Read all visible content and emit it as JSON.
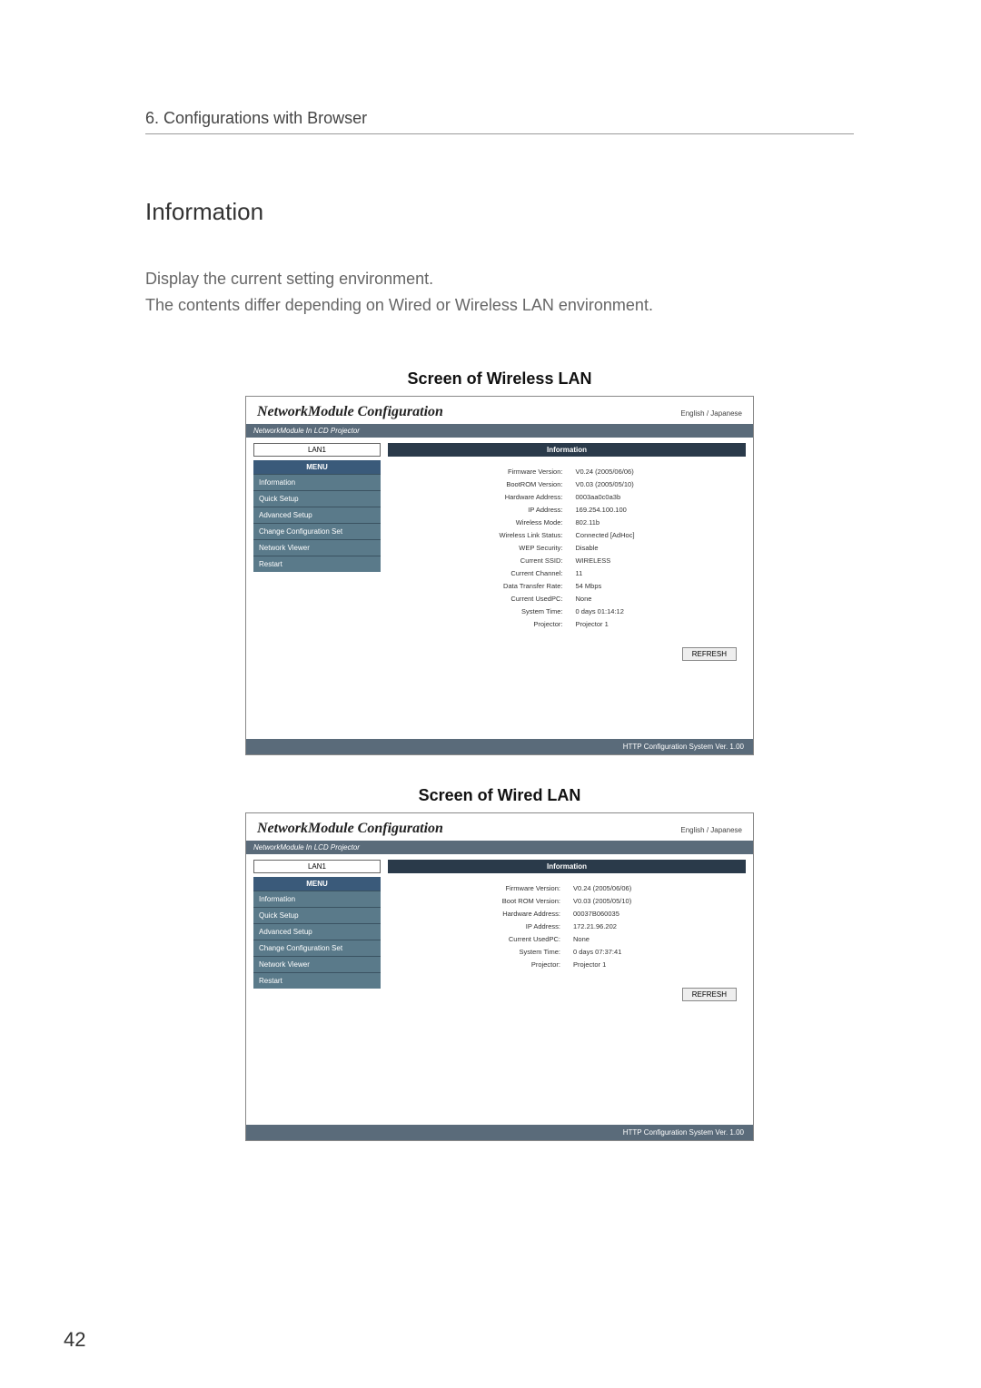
{
  "breadcrumb": "6. Configurations with Browser",
  "section_title": "Information",
  "intro1": "Display the current setting environment.",
  "intro2": "The contents differ depending on Wired or Wireless LAN environment.",
  "caption_wireless": "Screen of Wireless LAN",
  "caption_wired": "Screen of Wired LAN",
  "cfg_title": "NetworkModule Configuration",
  "lang_label": "English / Japanese",
  "subtitle": "NetworkModule In LCD Projector",
  "lan1": "LAN1",
  "menu_header": "MENU",
  "menu_items": [
    "Information",
    "Quick Setup",
    "Advanced Setup",
    "Change Configuration Set",
    "Network Viewer",
    "Restart"
  ],
  "info_header": "Information",
  "refresh": "REFRESH",
  "wireless_rows": [
    [
      "Firmware Version:",
      "V0.24 (2005/06/06)"
    ],
    [
      "BootROM Version:",
      "V0.03 (2005/05/10)"
    ],
    [
      "Hardware Address:",
      "0003aa0c0a3b"
    ],
    [
      "IP Address:",
      "169.254.100.100"
    ],
    [
      "Wireless Mode:",
      "802.11b"
    ],
    [
      "Wireless Link Status:",
      "Connected [AdHoc]"
    ],
    [
      "WEP Security:",
      "Disable"
    ],
    [
      "Current SSID:",
      "WIRELESS"
    ],
    [
      "Current Channel:",
      "11"
    ],
    [
      "Data Transfer Rate:",
      "54 Mbps"
    ],
    [
      "Current UsedPC:",
      "None"
    ],
    [
      "System Time:",
      "0 days 01:14:12"
    ],
    [
      "Projector:",
      "Projector 1"
    ]
  ],
  "wired_rows": [
    [
      "Firmware Version:",
      "V0.24 (2005/06/06)"
    ],
    [
      "Boot ROM Version:",
      "V0.03 (2005/05/10)"
    ],
    [
      "Hardware Address:",
      "00037B060035"
    ],
    [
      "IP Address:",
      "172.21.96.202"
    ],
    [
      "Current UsedPC:",
      "None"
    ],
    [
      "System Time:",
      "0 days 07:37:41"
    ],
    [
      "Projector:",
      "Projector 1"
    ]
  ],
  "footer_bar": "HTTP Configuration System Ver. 1.00",
  "page_number": "42"
}
